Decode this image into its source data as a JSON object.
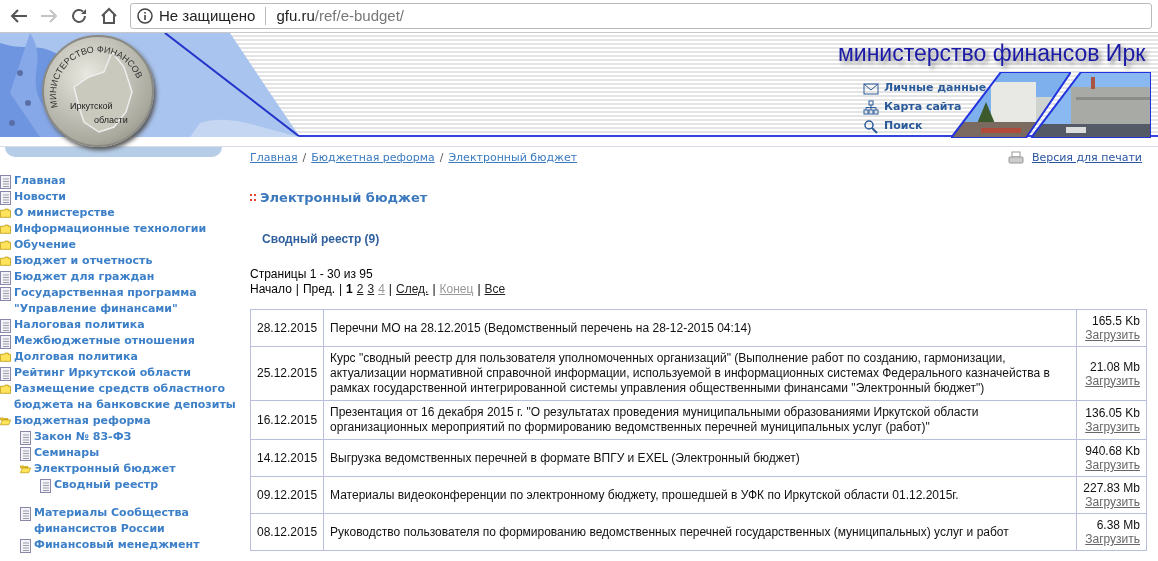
{
  "browser": {
    "forward": {
      "disabled": true
    },
    "address_bar": {
      "security": "Не защищено",
      "host": "gfu.ru",
      "path": "/ref/e-budget/"
    }
  },
  "header": {
    "emblem": {
      "arc": "МИНИСТЕРСТВО ФИНАНСОВ",
      "line_1": "Иркутской",
      "line_2": "области"
    },
    "title": "министерство финансов Ирк",
    "links": [
      {
        "kind": "mail",
        "label": "Личные данные"
      },
      {
        "kind": "sitemap",
        "label": "Карта сайта"
      },
      {
        "kind": "search",
        "label": "Поиск"
      }
    ]
  },
  "sidebar": {
    "items": [
      {
        "kind": "page",
        "label": "Главная"
      },
      {
        "kind": "page",
        "label": "Новости"
      },
      {
        "kind": "folder",
        "label": "О министерстве"
      },
      {
        "kind": "folder",
        "label": "Информационные технологии"
      },
      {
        "kind": "folder",
        "label": "Обучение"
      },
      {
        "kind": "folder",
        "label": "Бюджет и отчетность"
      },
      {
        "kind": "page",
        "label": "Бюджет для граждан"
      },
      {
        "kind": "page",
        "label": "Государственная программа \"Управление финансами\""
      },
      {
        "kind": "page",
        "label": "Налоговая политика"
      },
      {
        "kind": "page",
        "label": "Межбюджетные отношения"
      },
      {
        "kind": "folder",
        "label": "Долговая политика"
      },
      {
        "kind": "page",
        "label": "Рейтинг Иркутской области"
      },
      {
        "kind": "folder",
        "label": "Размещение средств областного бюджета на банковские депозиты"
      },
      {
        "kind": "open-folder",
        "label": "Бюджетная реформа",
        "children": [
          {
            "kind": "page",
            "label": "Закон № 83-ФЗ"
          },
          {
            "kind": "page",
            "label": "Семинары"
          },
          {
            "kind": "open-folder",
            "label": "Электронный бюджет",
            "children": [
              {
                "kind": "page",
                "label": "Сводный реестр"
              }
            ]
          },
          {
            "kind": "page",
            "label": "Материалы Сообщества финансистов России"
          },
          {
            "kind": "page",
            "label": "Финансовый менеджмент"
          }
        ]
      }
    ]
  },
  "breadcrumb": {
    "separator": "/",
    "items": [
      "Главная",
      "Бюджетная реформа",
      "Электронный бюджет"
    ]
  },
  "print_link": "Версия для печати",
  "page_title": "Электронный бюджет",
  "section_link": "Сводный реестр (9)",
  "pages_summary": "Страницы 1 - 30 из 95",
  "pagination": [
    {
      "kind": "text",
      "text": "Начало"
    },
    {
      "kind": "separator",
      "text": "|"
    },
    {
      "kind": "text",
      "text": "Пред."
    },
    {
      "kind": "separator",
      "text": "|"
    },
    {
      "kind": "current",
      "text": "1"
    },
    {
      "kind": "link",
      "text": "2",
      "disabled": false
    },
    {
      "kind": "link",
      "text": "3",
      "disabled": false
    },
    {
      "kind": "link",
      "text": "4",
      "disabled": true
    },
    {
      "kind": "separator",
      "text": "|"
    },
    {
      "kind": "link",
      "text": "След.",
      "disabled": false
    },
    {
      "kind": "separator",
      "text": "|"
    },
    {
      "kind": "link",
      "text": "Конец",
      "disabled": true
    },
    {
      "kind": "separator",
      "text": "|"
    },
    {
      "kind": "link",
      "text": "Все",
      "disabled": false
    }
  ],
  "table": {
    "rows": [
      {
        "date": "28.12.2015",
        "title": "Перечни МО на 28.12.2015 (Ведомственный перечень на 28-12-2015 04:14)",
        "size": "165.5 Kb",
        "action": "Загрузить"
      },
      {
        "date": "25.12.2015",
        "title": "Курс \"сводный реестр для пользователя уполномоченных организаций\" (Выполнение работ по созданию, гармонизации, актуализации нормативной справочной информации, используемой в информационных системах Федерального казначейства в рамках государственной интегрированной системы управления общественными финансами \"Электронный бюджет\")",
        "size": "21.08 Mb",
        "action": "Загрузить"
      },
      {
        "date": "16.12.2015",
        "title": "Презентация от 16 декабря 2015 г. \"О результатах проведения муниципальными образованиями Иркутской области организационных мероприятий по формированию ведомственных перечней муниципальных услуг (работ)\"",
        "size": "136.05 Kb",
        "action": "Загрузить"
      },
      {
        "date": "14.12.2015",
        "title": "Выгрузка ведомственных перечней в формате ВПГУ и EXEL (Электронный бюджет)",
        "size": "940.68 Kb",
        "action": "Загрузить"
      },
      {
        "date": "09.12.2015",
        "title": "Материалы видеоконференции по электронному бюджету, прошедшей в УФК по Иркутской области 01.12.2015г.",
        "size": "227.83 Mb",
        "action": "Загрузить"
      },
      {
        "date": "08.12.2015",
        "title": "Руководство пользователя по формированию ведомственных перечней государственных (муниципальных) услуг и работ",
        "size": "6.38 Mb",
        "action": "Загрузить"
      }
    ]
  }
}
